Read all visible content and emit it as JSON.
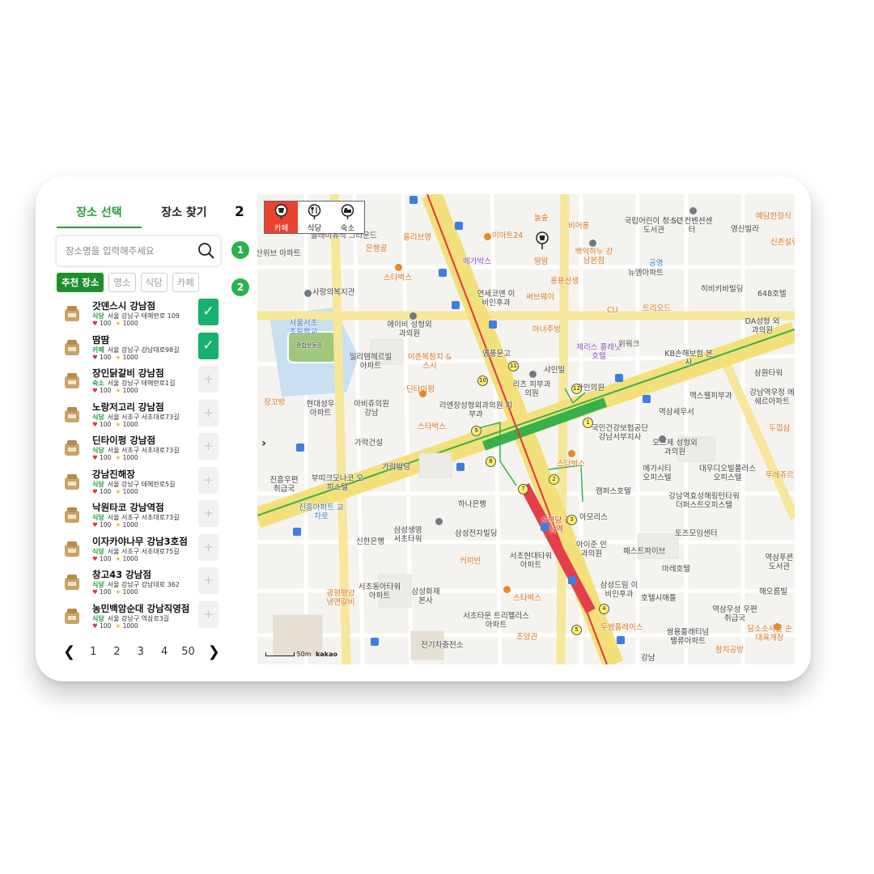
{
  "tabs": {
    "select": "장소 선택",
    "find": "장소 찾기"
  },
  "step_top": "2",
  "steps": [
    "1",
    "2"
  ],
  "search": {
    "placeholder": "장소명을 입력해주세요"
  },
  "filters": [
    "추천 장소",
    "명소",
    "식당",
    "카페"
  ],
  "places": [
    {
      "name": "갓덴스시 강남점",
      "category": "식당",
      "address": "서울 강남구 테헤란로 109",
      "likes": "100",
      "rating": "1000",
      "checked": true
    },
    {
      "name": "땀땀",
      "category": "카페",
      "address": "서울 강남구 강남대로98길",
      "likes": "100",
      "rating": "1000",
      "checked": true
    },
    {
      "name": "장인닭갈비 강남점",
      "category": "숙소",
      "address": "서울 강남구 테헤란로1길",
      "likes": "100",
      "rating": "1000",
      "checked": false
    },
    {
      "name": "노랑저고리 강남점",
      "category": "식당",
      "address": "서울 서초구 서초대로73길",
      "likes": "100",
      "rating": "1000",
      "checked": false
    },
    {
      "name": "딘타이펑 강남점",
      "category": "식당",
      "address": "서울 서초구 서초대로73길",
      "likes": "100",
      "rating": "1000",
      "checked": false
    },
    {
      "name": "강남진해장",
      "category": "식당",
      "address": "서울 강남구 테헤란로5길",
      "likes": "100",
      "rating": "1000",
      "checked": false
    },
    {
      "name": "낙원타코 강남역점",
      "category": "식당",
      "address": "서울 서초구 서초대로73길",
      "likes": "100",
      "rating": "1000",
      "checked": false
    },
    {
      "name": "이자카야나무 강남3호점",
      "category": "식당",
      "address": "서울 서초구 서초대로75길",
      "likes": "100",
      "rating": "1000",
      "checked": false
    },
    {
      "name": "창고43 강남점",
      "category": "식당",
      "address": "서울 강남구 강남대로 362",
      "likes": "100",
      "rating": "1000",
      "checked": false
    },
    {
      "name": "농민백암순대 강남직영점",
      "category": "식당",
      "address": "서울 강남구 역삼로3길",
      "likes": "100",
      "rating": "1000",
      "checked": false
    }
  ],
  "pagination": {
    "prev": "❮",
    "pages": [
      "1",
      "2",
      "3",
      "4",
      "50"
    ],
    "next": "❯"
  },
  "map": {
    "categories": [
      "카페",
      "식당",
      "숙소"
    ],
    "expand_arrow": "›",
    "scale_label": "50m",
    "provider": "kakao",
    "labels": [
      "산위브 아파트",
      "놀래미뮤직 그라운드",
      "은행골",
      "올리브영",
      "이마트24",
      "메가박스",
      "놀숲",
      "비어롱",
      "국립어린이 청소년도서관",
      "SC 컨벤션센터",
      "영신빌라",
      "예담한정식",
      "신촌설렁",
      "땀땀",
      "백억하누 강남본점",
      "용용선생",
      "뉴엠아파트",
      "공영",
      "히비키바빌딩",
      "648호텔",
      "스타벅스",
      "사랑의복지관",
      "연세코앤 이비인후과",
      "써브웨이",
      "CU",
      "트리오드",
      "DA성형 외과의원",
      "서울서초 초등학교",
      "종합운동장",
      "에이비 성형외과의원",
      "마녀주방",
      "제리스 플레닛호텔",
      "위워크",
      "밀리템헤르빌 아파트",
      "이춘복참치 &스시",
      "영풍문고",
      "샤인빌",
      "리츠 피부과의원",
      "KB손해보험 본사",
      "삼원타워",
      "장꼬방",
      "현대성우 아파트",
      "아비쥬의원 강남",
      "딘타이펑",
      "리엔장성형외과의원 피부과",
      "라인의원",
      "맥스웰피부과",
      "강남역우정 에쉐르아파트",
      "역삼세무서",
      "스타벅스",
      "국민건강보험공단 강남서부지사",
      "두껍삼",
      "가락건설",
      "오브제 성형외과의원",
      "진흥우편 취급국",
      "부띠크모나코 오피스텔",
      "가락빌딩",
      "스타벅스",
      "메가시티 오피스텔",
      "대우디오빌플러스 오피스텔",
      "뚜레쥬르",
      "캠퍼스호텔",
      "진흥아파트 교차로",
      "하나은행",
      "신분당 강남역",
      "강남역효성해링턴타워 더퍼스트오피스텔",
      "신한은행",
      "삼성생명 서초타워",
      "삼성전자빌딩",
      "아모리스",
      "토즈모임센터",
      "아이준 안과의원",
      "패스트파이브",
      "커피빈",
      "서초현대타워 아파트",
      "역삼푸른 도서관",
      "마레호텔",
      "광평평양 냉면갈비",
      "서초동아타워 아파트",
      "삼성화재 본사",
      "삼성드림 이비인후과",
      "호텔시애틀",
      "해오름빌",
      "스타벅스",
      "서초타운 트리펠리스아파트",
      "역삼우성 우편취급국",
      "전기차충전소",
      "조양관",
      "두썸플레이스",
      "쌍용플래티넘 밸류아파트",
      "담소소사골 순대육개장",
      "참치공방",
      "강남"
    ]
  }
}
